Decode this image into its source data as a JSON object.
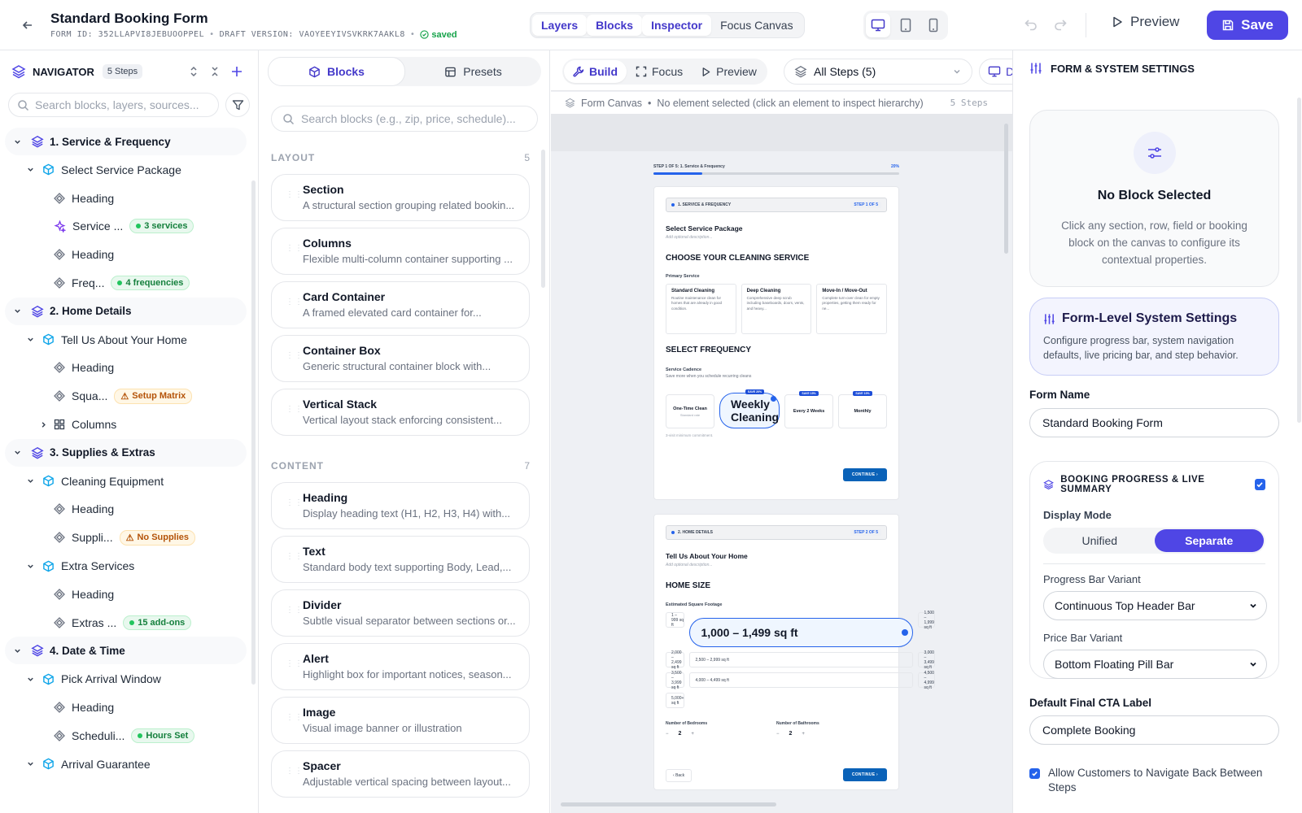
{
  "header": {
    "title": "Standard Booking Form",
    "form_id": "FORM ID: 352LLAPVI8JEBUOOPPEL",
    "draft_version": "DRAFT VERSION: VAOYEEYIVSVKRK7AAKL8",
    "saved": "saved",
    "tabs": [
      "Layers",
      "Blocks",
      "Inspector",
      "Focus Canvas"
    ],
    "preview_label": "Preview",
    "save_label": "Save"
  },
  "navigator": {
    "title": "NAVIGATOR",
    "badge": "5 Steps",
    "search_placeholder": "Search blocks, layers, sources...",
    "items": [
      {
        "label": "1. Service & Frequency",
        "level": 0,
        "type": "step"
      },
      {
        "label": "Select Service Package",
        "level": 1,
        "type": "section"
      },
      {
        "label": "Heading",
        "level": 2,
        "type": "block"
      },
      {
        "label": "Service ...",
        "level": 2,
        "type": "service",
        "pill": "3 services",
        "pill_color": "green"
      },
      {
        "label": "Heading",
        "level": 2,
        "type": "block"
      },
      {
        "label": "Freq...",
        "level": 2,
        "type": "block",
        "pill": "4 frequencies",
        "pill_color": "green"
      },
      {
        "label": "2. Home Details",
        "level": 0,
        "type": "step"
      },
      {
        "label": "Tell Us About Your Home",
        "level": 1,
        "type": "section"
      },
      {
        "label": "Heading",
        "level": 2,
        "type": "block"
      },
      {
        "label": "Squa...",
        "level": 2,
        "type": "block",
        "pill": "Setup Matrix",
        "pill_color": "amber"
      },
      {
        "label": "Columns",
        "level": 2,
        "type": "columns",
        "collapsed": true
      },
      {
        "label": "3. Supplies & Extras",
        "level": 0,
        "type": "step"
      },
      {
        "label": "Cleaning Equipment",
        "level": 1,
        "type": "section"
      },
      {
        "label": "Heading",
        "level": 2,
        "type": "block"
      },
      {
        "label": "Suppli...",
        "level": 2,
        "type": "block",
        "pill": "No Supplies",
        "pill_color": "amber"
      },
      {
        "label": "Extra Services",
        "level": 1,
        "type": "section"
      },
      {
        "label": "Heading",
        "level": 2,
        "type": "block"
      },
      {
        "label": "Extras ...",
        "level": 2,
        "type": "block",
        "pill": "15 add-ons",
        "pill_color": "green"
      },
      {
        "label": "4. Date & Time",
        "level": 0,
        "type": "step"
      },
      {
        "label": "Pick Arrival Window",
        "level": 1,
        "type": "section"
      },
      {
        "label": "Heading",
        "level": 2,
        "type": "block"
      },
      {
        "label": "Scheduli...",
        "level": 2,
        "type": "block",
        "pill": "Hours Set",
        "pill_color": "green"
      },
      {
        "label": "Arrival Guarantee",
        "level": 1,
        "type": "section"
      }
    ]
  },
  "blocks": {
    "tabs": [
      "Blocks",
      "Presets"
    ],
    "search_placeholder": "Search blocks (e.g., zip, price, schedule)...",
    "sections": [
      {
        "title": "LAYOUT",
        "count": "5",
        "items": [
          {
            "name": "Section",
            "desc": "A structural section grouping related bookin..."
          },
          {
            "name": "Columns",
            "desc": "Flexible multi-column container supporting ..."
          },
          {
            "name": "Card Container",
            "desc": "A framed elevated card container for..."
          },
          {
            "name": "Container Box",
            "desc": "Generic structural container block with..."
          },
          {
            "name": "Vertical Stack",
            "desc": "Vertical layout stack enforcing consistent..."
          }
        ]
      },
      {
        "title": "CONTENT",
        "count": "7",
        "items": [
          {
            "name": "Heading",
            "desc": "Display heading text (H1, H2, H3, H4) with..."
          },
          {
            "name": "Text",
            "desc": "Standard body text supporting Body, Lead,..."
          },
          {
            "name": "Divider",
            "desc": "Subtle visual separator between sections or..."
          },
          {
            "name": "Alert",
            "desc": "Highlight box for important notices, season..."
          },
          {
            "name": "Image",
            "desc": "Visual image banner or illustration"
          },
          {
            "name": "Spacer",
            "desc": "Adjustable vertical spacing between layout..."
          }
        ]
      }
    ]
  },
  "canvas": {
    "toolbar_tabs": [
      "Build",
      "Focus",
      "Preview"
    ],
    "step_select": "All Steps (5)",
    "toolbar_extra": "D",
    "breadcrumb_root": "Form Canvas",
    "breadcrumb_hint": "No element selected (click an element to inspect hierarchy)",
    "steps_count": "5 Steps",
    "progress": {
      "label": "STEP 1 OF 5: 1. Service & Frequency",
      "percent_label": "20%",
      "value": 0.2
    },
    "card1": {
      "step_chip": "1. SERVICE & FREQUENCY",
      "step_tag": "STEP 1 OF 5",
      "title": "Select Service Package",
      "subtitle": "Add optional description...",
      "h1": "CHOOSE YOUR CLEANING SERVICE",
      "service_label": "Primary Service",
      "services": [
        {
          "name": "Standard Cleaning",
          "desc": "Routine maintenance clean for homes that are already in good condition."
        },
        {
          "name": "Deep Cleaning",
          "desc": "Comprehensive deep scrub including baseboards, doors, vents, and heavy..."
        },
        {
          "name": "Move-In / Move-Out",
          "desc": "Complete turn-over clean for empty properties, getting them ready for ne..."
        }
      ],
      "h2": "SELECT FREQUENCY",
      "freq_label": "Service Cadence",
      "freq_sub": "Save more when you schedule recurring cleans",
      "frequencies": [
        {
          "name": "One-Time Clean",
          "sub": "Standard rate",
          "badge": ""
        },
        {
          "name": "Weekly Cleaning",
          "sub": "",
          "badge": "SAVE 20%",
          "selected": true
        },
        {
          "name": "Every 2 Weeks",
          "sub": "",
          "badge": "SAVE 15%"
        },
        {
          "name": "Monthly",
          "sub": "",
          "badge": "SAVE 10%"
        }
      ],
      "note": "3-visit minimum commitment.",
      "continue": "CONTINUE"
    },
    "card2": {
      "step_chip": "2. HOME DETAILS",
      "step_tag": "STEP 2 OF 5",
      "title": "Tell Us About Your Home",
      "subtitle": "Add optional description...",
      "h1": "HOME SIZE",
      "sq_label": "Estimated Square Footage",
      "sizes": [
        "1 – 999 sq ft",
        "1,000 – 1,499 sq ft",
        "1,500 – 1,999 sq ft",
        "2,000 – 2,499 sq ft",
        "2,500 – 2,999 sq ft",
        "3,000 – 3,499 sq ft",
        "3,500 – 3,999 sq ft",
        "4,000 – 4,499 sq ft",
        "4,500 – 4,999 sq ft",
        "5,000+ sq ft"
      ],
      "bedrooms_label": "Number of Bedrooms",
      "bedrooms": "2",
      "bathrooms_label": "Number of Bathrooms",
      "bathrooms": "2",
      "back": "Back",
      "continue": "CONTINUE"
    }
  },
  "settings": {
    "title": "FORM & SYSTEM SETTINGS",
    "no_block_title": "No Block Selected",
    "no_block_text": "Click any section, row, field or booking block on the canvas to configure its contextual properties.",
    "form_level_title": "Form-Level System Settings",
    "form_level_text": "Configure progress bar, system navigation defaults, live pricing bar, and step behavior.",
    "form_name_label": "Form Name",
    "form_name": "Standard Booking Form",
    "bp_title": "BOOKING PROGRESS & LIVE SUMMARY",
    "display_mode_label": "Display Mode",
    "display_modes": [
      "Unified",
      "Separate"
    ],
    "progress_variant_label": "Progress Bar Variant",
    "progress_variant": "Continuous Top Header Bar",
    "price_variant_label": "Price Bar Variant",
    "price_variant": "Bottom Floating Pill Bar",
    "cta_label": "Default Final CTA Label",
    "cta": "Complete Booking",
    "allow_back": "Allow Customers to Navigate Back Between Steps"
  },
  "colors": {
    "accent": "#4f46e5",
    "link_blue": "#2563eb",
    "green": "#16a34a",
    "amber": "#b45309"
  }
}
